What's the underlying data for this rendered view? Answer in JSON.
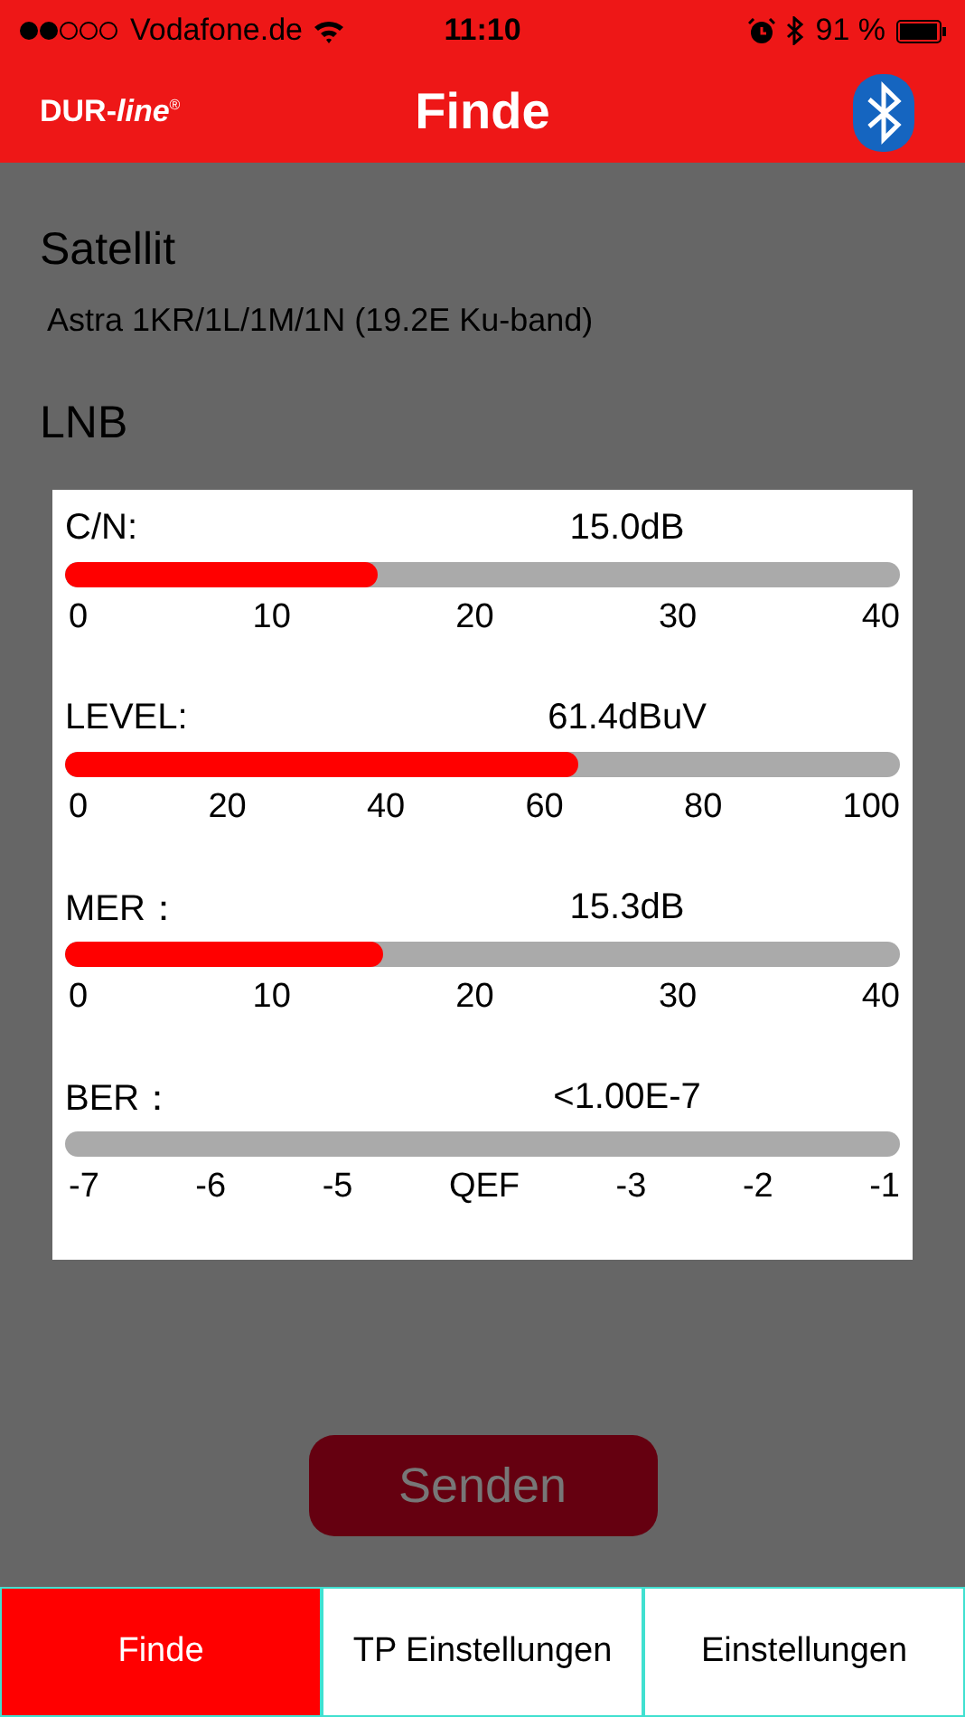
{
  "status_bar": {
    "carrier": "Vodafone.de",
    "time": "11:10",
    "battery": "91 %"
  },
  "nav_bar": {
    "logo": "DUR-",
    "logo_italic": "line",
    "logo_mark": "®",
    "title": "Finde"
  },
  "form": {
    "satellite_label": "Satellit",
    "satellite_value": "Astra 1KR/1L/1M/1N (19.2E Ku-band)",
    "lnb_label": "LNB",
    "send_button": "Senden"
  },
  "meters": [
    {
      "label": "C/N:",
      "reading": "15.0dB",
      "level": 0.374,
      "ticks": [
        "0",
        "10",
        "20",
        "30",
        "40"
      ]
    },
    {
      "label": "LEVEL:",
      "reading": "61.4dBuV",
      "level": 0.614,
      "ticks": [
        "0",
        "20",
        "40",
        "60",
        "80",
        "100"
      ]
    },
    {
      "label": "MER：",
      "reading": "15.3dB",
      "level": 0.382,
      "ticks": [
        "0",
        "10",
        "20",
        "30",
        "40"
      ]
    },
    {
      "label": "BER：",
      "reading": "<1.00E-7",
      "ticks": [
        "-7",
        "-6",
        "-5",
        "QEF",
        "-3",
        "-2",
        "-1"
      ]
    }
  ],
  "tabs": [
    {
      "label": "Finde",
      "selected": true
    },
    {
      "label": "TP Einstellungen",
      "selected": false
    },
    {
      "label": "Einstellungen",
      "selected": false
    }
  ]
}
